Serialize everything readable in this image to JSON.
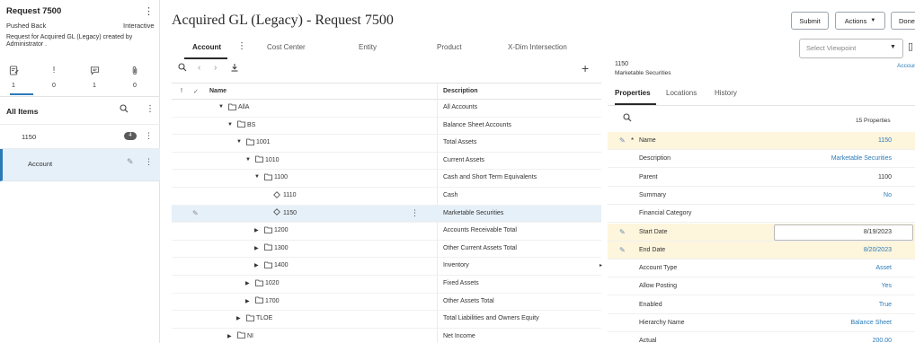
{
  "request": {
    "title": "Request 7500",
    "status": "Pushed Back",
    "mode": "Interactive",
    "description": "Request for Acquired GL (Legacy) created by Administrator ."
  },
  "left_tabs": {
    "icons": [
      "request-details-icon",
      "issues-icon",
      "comments-icon",
      "attachments-icon"
    ],
    "counts": [
      "1",
      "0",
      "1",
      "0"
    ]
  },
  "items": {
    "header": "All Items",
    "item_label": "1150",
    "item_badge": "4",
    "sub_item_label": "Account"
  },
  "main": {
    "title": "Acquired GL (Legacy) - Request 7500",
    "tabs": [
      "Account",
      "Cost Center",
      "Entity",
      "Product",
      "X-Dim Intersection"
    ],
    "grid_headers": {
      "flag": "!",
      "check": "✓",
      "name": "Name",
      "description": "Description"
    },
    "rows": [
      {
        "name": "AllA",
        "description": "All Accounts",
        "level": 0,
        "type": "folder",
        "expand": "open"
      },
      {
        "name": "BS",
        "description": "Balance Sheet Accounts",
        "level": 1,
        "type": "folder",
        "expand": "open"
      },
      {
        "name": "1001",
        "description": "Total Assets",
        "level": 2,
        "type": "folder",
        "expand": "open"
      },
      {
        "name": "1010",
        "description": "Current Assets",
        "level": 3,
        "type": "folder",
        "expand": "open"
      },
      {
        "name": "1100",
        "description": "Cash and Short Term Equivalents",
        "level": 4,
        "type": "folder",
        "expand": "open"
      },
      {
        "name": "1110",
        "description": "Cash",
        "level": 5,
        "type": "leaf",
        "expand": "none"
      },
      {
        "name": "1150",
        "description": "Marketable Securities",
        "level": 5,
        "type": "leaf",
        "expand": "none",
        "selected": true
      },
      {
        "name": "1200",
        "description": "Accounts Receivable Total",
        "level": 4,
        "type": "folder",
        "expand": "closed"
      },
      {
        "name": "1300",
        "description": "Other Current Assets Total",
        "level": 4,
        "type": "folder",
        "expand": "closed"
      },
      {
        "name": "1400",
        "description": "Inventory",
        "level": 4,
        "type": "folder",
        "expand": "closed"
      },
      {
        "name": "1020",
        "description": "Fixed Assets",
        "level": 3,
        "type": "folder",
        "expand": "closed"
      },
      {
        "name": "1700",
        "description": "Other Assets Total",
        "level": 3,
        "type": "folder",
        "expand": "closed"
      },
      {
        "name": "TLOE",
        "description": "Total Liabilities and Owners Equity",
        "level": 2,
        "type": "folder",
        "expand": "closed"
      },
      {
        "name": "NI",
        "description": "Net Income",
        "level": 1,
        "type": "folder",
        "expand": "closed"
      }
    ]
  },
  "right": {
    "buttons": {
      "submit": "Submit",
      "actions": "Actions",
      "done": "Done"
    },
    "viewpoint_placeholder": "Select Viewpoint",
    "node_code": "1150",
    "node_name": "Marketable Securities",
    "node_type": "Account",
    "tabs": [
      "Properties",
      "Locations",
      "History"
    ],
    "properties_count": "15 Properties",
    "properties": [
      {
        "label": "Name",
        "value": "1150",
        "required": true,
        "editable": true,
        "highlight": true,
        "link": true
      },
      {
        "label": "Description",
        "value": "Marketable Securities",
        "link": true
      },
      {
        "label": "Parent",
        "value": "1100"
      },
      {
        "label": "Summary",
        "value": "No",
        "link": true
      },
      {
        "label": "Financial Category",
        "value": ""
      },
      {
        "label": "Start Date",
        "value": "8/19/2023",
        "editable": true,
        "highlight": true,
        "date_box": true
      },
      {
        "label": "End Date",
        "value": "8/20/2023",
        "editable": true,
        "highlight": true,
        "link": true
      },
      {
        "label": "Account Type",
        "value": "Asset",
        "link": true
      },
      {
        "label": "Allow Posting",
        "value": "Yes",
        "link": true
      },
      {
        "label": "Enabled",
        "value": "True",
        "link": true
      },
      {
        "label": "Hierarchy Name",
        "value": "Balance Sheet",
        "link": true
      },
      {
        "label": "Actual",
        "value": "200.00",
        "link": true
      }
    ]
  },
  "colors": {
    "accent": "#2a7ab8",
    "highlight_row": "#fdf5dc",
    "selected_row": "#e6f0f8"
  }
}
